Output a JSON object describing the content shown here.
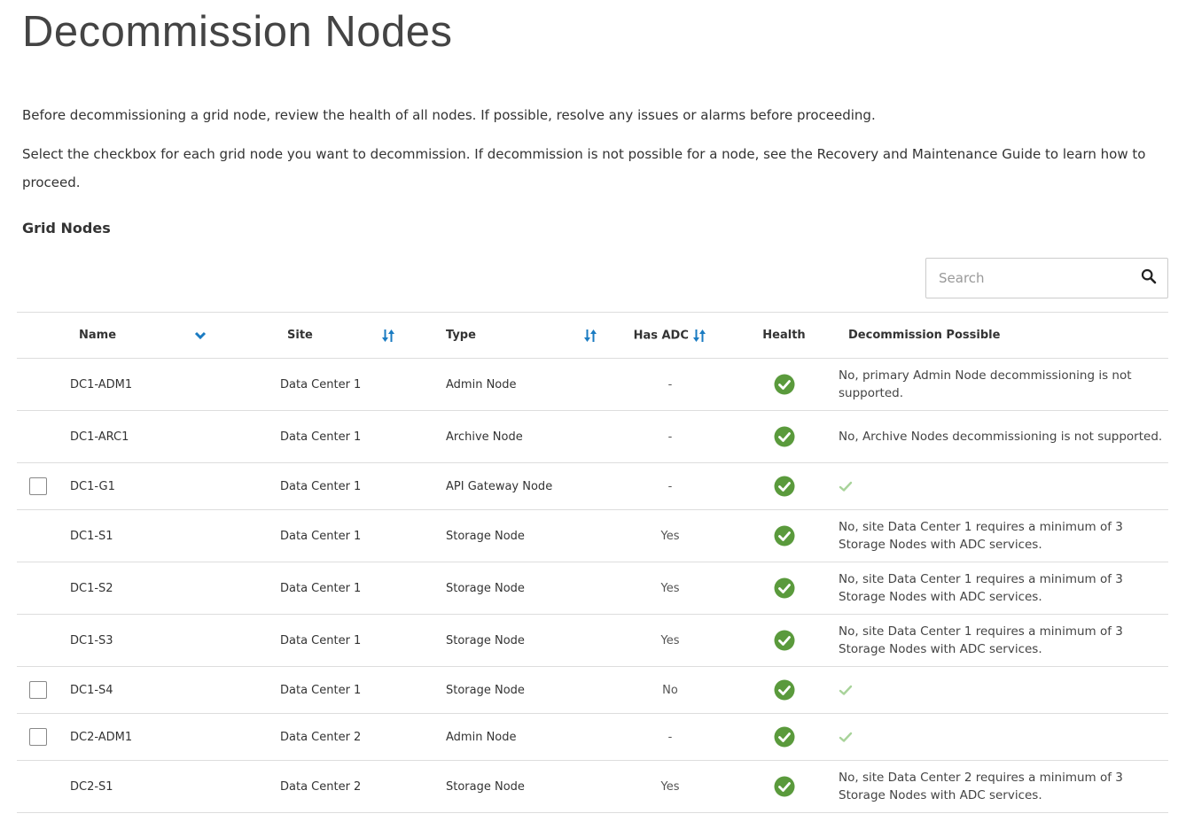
{
  "page": {
    "title": "Decommission Nodes",
    "intro_1": "Before decommissioning a grid node, review the health of all nodes. If possible, resolve any issues or alarms before proceeding.",
    "intro_2": "Select the checkbox for each grid node you want to decommission. If decommission is not possible for a node, see the Recovery and Maintenance Guide to learn how to proceed."
  },
  "grid_nodes": {
    "section_title": "Grid Nodes",
    "search": {
      "placeholder": "Search",
      "value": ""
    },
    "columns": {
      "name": "Name",
      "site": "Site",
      "type": "Type",
      "has_adc": "Has ADC",
      "health": "Health",
      "decommission_possible": "Decommission Possible"
    },
    "sort": {
      "active_column": "Name",
      "direction": "descending"
    },
    "rows": [
      {
        "selectable": false,
        "name": "DC1-ADM1",
        "site": "Data Center 1",
        "type": "Admin Node",
        "has_adc": "-",
        "health": "ok",
        "decommission": "No, primary Admin Node decommissioning is not supported."
      },
      {
        "selectable": false,
        "name": "DC1-ARC1",
        "site": "Data Center 1",
        "type": "Archive Node",
        "has_adc": "-",
        "health": "ok",
        "decommission": "No, Archive Nodes decommissioning is not supported."
      },
      {
        "selectable": true,
        "name": "DC1-G1",
        "site": "Data Center 1",
        "type": "API Gateway Node",
        "has_adc": "-",
        "health": "ok",
        "decommission": ""
      },
      {
        "selectable": false,
        "name": "DC1-S1",
        "site": "Data Center 1",
        "type": "Storage Node",
        "has_adc": "Yes",
        "health": "ok",
        "decommission": "No, site Data Center 1 requires a minimum of 3 Storage Nodes with ADC services."
      },
      {
        "selectable": false,
        "name": "DC1-S2",
        "site": "Data Center 1",
        "type": "Storage Node",
        "has_adc": "Yes",
        "health": "ok",
        "decommission": "No, site Data Center 1 requires a minimum of 3 Storage Nodes with ADC services."
      },
      {
        "selectable": false,
        "name": "DC1-S3",
        "site": "Data Center 1",
        "type": "Storage Node",
        "has_adc": "Yes",
        "health": "ok",
        "decommission": "No, site Data Center 1 requires a minimum of 3 Storage Nodes with ADC services."
      },
      {
        "selectable": true,
        "name": "DC1-S4",
        "site": "Data Center 1",
        "type": "Storage Node",
        "has_adc": "No",
        "health": "ok",
        "decommission": ""
      },
      {
        "selectable": true,
        "name": "DC2-ADM1",
        "site": "Data Center 2",
        "type": "Admin Node",
        "has_adc": "-",
        "health": "ok",
        "decommission": ""
      },
      {
        "selectable": false,
        "name": "DC2-S1",
        "site": "Data Center 2",
        "type": "Storage Node",
        "has_adc": "Yes",
        "health": "ok",
        "decommission": "No, site Data Center 2 requires a minimum of 3 Storage Nodes with ADC services."
      }
    ]
  },
  "icons": {
    "health_ok": "health-ok-icon",
    "decommission_possible": "check-mark-icon",
    "sort": "sort-icon",
    "sort_active": "chevron-down-icon",
    "search": "search-icon"
  },
  "colors": {
    "accent": "#1a7bc2",
    "health_ok": "#5a9a3c",
    "possible_check": "#a8d39a",
    "border": "#dddddd"
  }
}
